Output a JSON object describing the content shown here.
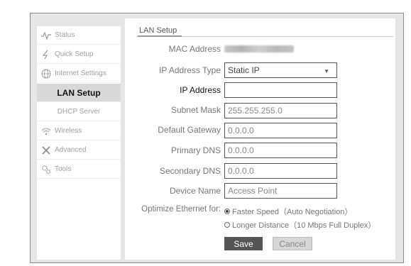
{
  "sidebar": {
    "items": [
      {
        "label": "Status",
        "icon": "pulse-icon"
      },
      {
        "label": "Quick Setup",
        "icon": "lightning-icon"
      },
      {
        "label": "Internet Settings",
        "icon": "globe-icon"
      },
      {
        "label": "LAN Setup",
        "active": true
      },
      {
        "label": "DHCP Server"
      },
      {
        "label": "Wireless",
        "icon": "wifi-icon"
      },
      {
        "label": "Advanced",
        "icon": "tools-cross-icon"
      },
      {
        "label": "Tools",
        "icon": "gears-icon"
      }
    ]
  },
  "section": {
    "title": "LAN Setup"
  },
  "form": {
    "mac_address_label": "MAC Address",
    "ip_type_label": "IP Address Type",
    "ip_type_value": "Static IP",
    "ip_address_label": "IP Address",
    "ip_address_value": "",
    "subnet_label": "Subnet Mask",
    "subnet_value": "255.255.255.0",
    "gateway_label": "Default Gateway",
    "gateway_value": "0.0.0.0",
    "primary_dns_label": "Primary DNS",
    "primary_dns_value": "0.0.0.0",
    "secondary_dns_label": "Secondary DNS",
    "secondary_dns_value": "0.0.0.0",
    "device_name_label": "Device Name",
    "device_name_placeholder": "Access Point",
    "optimize_label": "Optimize Ethernet for:",
    "option_fast": "Faster Speed（Auto Negotiation）",
    "option_long": "Longer Distance（10 Mbps Full Duplex）",
    "selected_option": "fast"
  },
  "buttons": {
    "save": "Save",
    "cancel": "Cancel"
  },
  "colors": {
    "frame_bg": "#e6e6e6",
    "active_nav": "#d9d9d9",
    "save_btn": "#555555",
    "cancel_btn": "#d7d7d7"
  }
}
